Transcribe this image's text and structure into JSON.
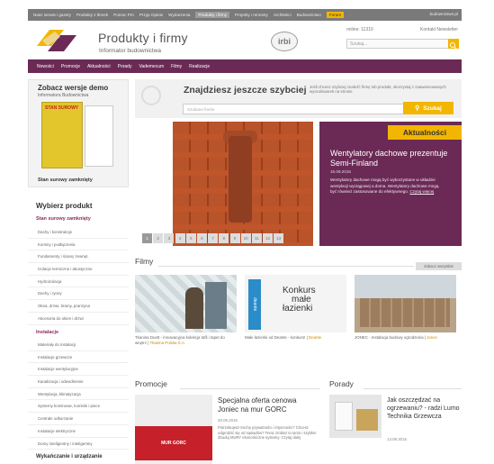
{
  "topbar": {
    "links": [
      "Nasz serwis i gazety",
      "Produkty z tlenek",
      "Pomoc Pro",
      "Przyp Opinie",
      "Wydarzenia",
      "Produkty i firmy",
      "Projekty i remonty",
      "Architekci",
      "Budownictwo",
      "Forum"
    ],
    "active_index": 5,
    "highlight_index": 9,
    "user": "budownictwo.pl"
  },
  "header": {
    "brand": "Produkty i firmy",
    "subtitle": "Informator budownictwa",
    "irbi": "irbi",
    "online": "online: 11310",
    "links": "Kontakt   Newsletter",
    "search_placeholder": "Szukaj..."
  },
  "nav": [
    "Nowości",
    "Promocje",
    "Aktualności",
    "Porady",
    "Vademecum",
    "Filmy",
    "Realizacje"
  ],
  "demo": {
    "title": "Zobacz wersje demo",
    "subtitle": "Informatora Budownictwa",
    "book_title": "STAN SUROWY",
    "footer": "Stan surowy zamknięty"
  },
  "sidebar": {
    "heading": "Wybierz produkt",
    "group1": {
      "title": "Stan surowy zamknięty",
      "items": [
        "Dachy i konstrukcje",
        "Kominy i podłączenia",
        "Fundamenty i ściany zewnęt.",
        "Izolacje termiczne i akustyczne",
        "Hydroizolacja",
        "Dachy i rynny",
        "Okna, drzwi, bramy, pranżyna",
        "Akcesoria do okien i drzwi"
      ]
    },
    "group2": {
      "title": "Instalacje",
      "items": [
        "Materiały do instalacji",
        "Instalacje grzewcze",
        "Instalacje wentylacyjne",
        "Kanalizacja i odwodnienie",
        "Wentylacja, klimatyzacja",
        "Systemy kominowe, kominki i piece",
        "Centrale odkurzanie",
        "Instalacje elektryczne",
        "Domy inteligentny i inteligentny"
      ]
    },
    "group3_title": "Wykańczanie i urządzanie"
  },
  "search": {
    "title": "Znajdziesz jeszcze szybciej",
    "hint": "Jeśli chcesz szybciej znaleźć firmę lub produkt, skorzystaj z zaawansowanych wyszukiwarek na stronie",
    "placeholder": "Szukane frazie",
    "button": "Szukaj"
  },
  "news": {
    "label": "Aktualności",
    "title": "Wentylatory dachowe prezentuje Semi-Finland",
    "date": "15.09.2015",
    "body": "Wentylatory dachowe mogą być wykorzystane w układzie wentylacji wyciągowej a doma. Wentylatory dachowe mogą być również zastosowane do efektywnego.",
    "more": "Czytaj więcej"
  },
  "pager": [
    "1",
    "2",
    "3",
    "4",
    "5",
    "6",
    "7",
    "8",
    "9",
    "10",
    "11",
    "12",
    "13"
  ],
  "pager_active": 0,
  "films": {
    "title": "Filmy",
    "all": "Zobacz wszystkie",
    "items": [
      {
        "caption": "Tkanina Duett - innowacyjna kolekcja tafli i tapet do wnętrz |",
        "source": "Tkanina Polska S.A."
      },
      {
        "caption": "Małe łazienki od Deante - konkurs! |",
        "source": "Deante",
        "banner1": "Konkurs",
        "banner2": "małe",
        "banner3": "łazienki",
        "brand": "deante"
      },
      {
        "caption": "JONEC - Instalacja budowy ogrodzenia |",
        "source": "Jonec"
      }
    ]
  },
  "promo": {
    "title": "Promocje",
    "item_title": "Specjalna oferta cenowa Joniec na mur GORC",
    "date": "30.09.2015",
    "body": "Potrzebujesz trochę prywatności i intymności? Chcesz odgrodzić się od sąsiadów? Teraz zrobisz to tanio i szybko! Zbuduj MURY ekonomiczne systemy. Czytaj dalej",
    "banner": "MUR GORC"
  },
  "porady": {
    "title": "Porady",
    "item_title": "Jak oszczędzać na ogrzewaniu? - radzi Lumo Technika Grzewcza",
    "date": "13.09.2015"
  },
  "colors": {
    "purple": "#6b2a55",
    "yellow": "#f2b600"
  }
}
